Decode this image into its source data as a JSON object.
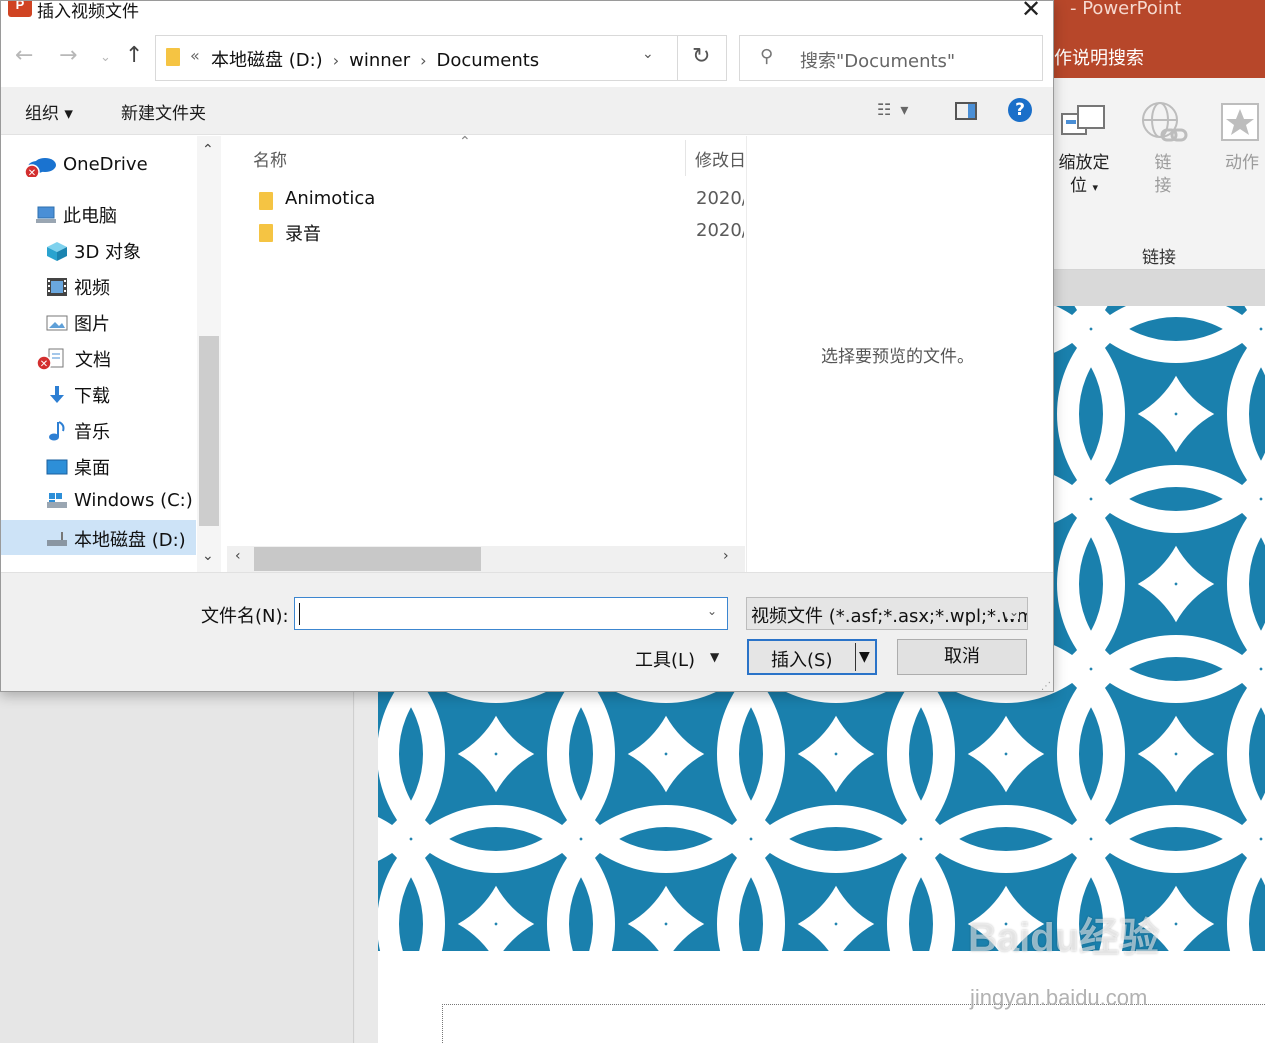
{
  "powerpoint": {
    "app_name": "- PowerPoint",
    "tell_me": "作说明搜索",
    "ribbon": {
      "zoom_label": "缩放定位",
      "zoom_label_line1": "缩放定",
      "zoom_label_line2": "位",
      "link_label": "链接",
      "link_line1": "链",
      "link_line2": "接",
      "action_label": "动作",
      "group_label": "链接"
    },
    "watermark": "Baidu经验",
    "watermark_url": "jingyan.baidu.com",
    "colors": {
      "title_bar": "#b7472a",
      "slide_background": "#1a80ad"
    }
  },
  "dialog": {
    "title": "插入视频文件",
    "close_glyph": "✕",
    "nav_buttons": {
      "back": "←",
      "forward": "→",
      "recent": "⌄",
      "up": "↑"
    },
    "address": {
      "overflow": "«",
      "breadcrumbs": [
        "本地磁盘 (D:)",
        "winner",
        "Documents"
      ],
      "separator": "›",
      "refresh_glyph": "↻"
    },
    "search": {
      "placeholder": "搜索\"Documents\"",
      "icon_glyph": "⚲"
    },
    "toolbar": {
      "organize": "组织 ▾",
      "new_folder": "新建文件夹",
      "view_glyph": "☷ ▾",
      "help": "?"
    },
    "nav_pane": {
      "items": [
        {
          "label": "OneDrive",
          "icon": "onedrive-icon",
          "status": "error"
        },
        {
          "label": "此电脑",
          "icon": "computer-icon"
        },
        {
          "label": "3D 对象",
          "icon": "cube-icon"
        },
        {
          "label": "视频",
          "icon": "video-icon"
        },
        {
          "label": "图片",
          "icon": "picture-icon"
        },
        {
          "label": "文档",
          "icon": "document-icon",
          "status": "error"
        },
        {
          "label": "下载",
          "icon": "download-icon"
        },
        {
          "label": "音乐",
          "icon": "music-icon"
        },
        {
          "label": "桌面",
          "icon": "desktop-icon"
        },
        {
          "label": "Windows (C:)",
          "icon": "drive-icon"
        },
        {
          "label": "本地磁盘 (D:)",
          "icon": "drive-icon",
          "selected": true
        }
      ]
    },
    "file_list": {
      "columns": {
        "name": "名称",
        "date": "修改日期"
      },
      "rows": [
        {
          "name": "Animotica",
          "date": "2020/"
        },
        {
          "name": "录音",
          "date": "2020/"
        }
      ]
    },
    "preview": {
      "message": "选择要预览的文件。"
    },
    "filename": {
      "label": "文件名(N):",
      "value": ""
    },
    "filetype": {
      "selected": "视频文件 (*.asf;*.asx;*.wpl;*.wm"
    },
    "buttons": {
      "tools": "工具(L)",
      "insert": "插入(S)",
      "cancel": "取消"
    },
    "colors": {
      "accent": "#2a73c8",
      "selection": "#cde3f7",
      "folder": "#f5c443"
    }
  }
}
